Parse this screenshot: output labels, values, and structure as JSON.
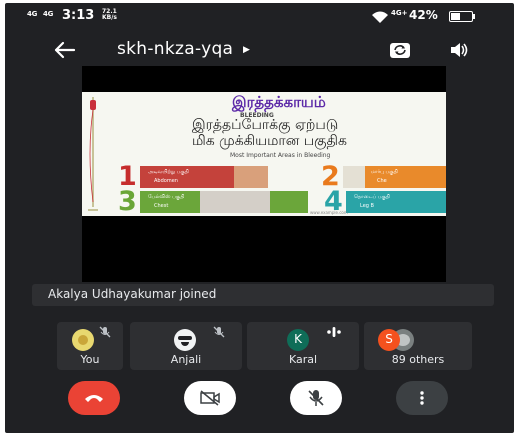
{
  "status_bar": {
    "net1": "4G",
    "net2": "4G",
    "time": "3:13",
    "speed_value": "72.1",
    "speed_unit": "KB/s",
    "wifi_label": "4G+",
    "battery": "42%"
  },
  "meeting": {
    "code": "skh-nkza-yqa",
    "back_icon": "arrow-left-icon",
    "switch_camera_icon": "switch-camera-icon",
    "audio_icon": "speaker-icon"
  },
  "presentation": {
    "title": "இரத்தக்காயம்",
    "subtitle": "BLEEDING",
    "line1": "இரத்தப்போக்கு ஏற்படு",
    "line2": "மிக முக்கியமான பகுதிக",
    "caption": "Most Important Areas in Bleeding",
    "cards": [
      {
        "number": "1",
        "label_ta": "அடிவயிற்று பகுதி",
        "label_en": "Abdomen"
      },
      {
        "number": "2",
        "label_ta": "மார்பு பகுதி",
        "label_en": "Che"
      },
      {
        "number": "3",
        "label_ta": "பேல்விஸ் பகுதி",
        "label_en": "Chest"
      },
      {
        "number": "4",
        "label_ta": "தொடைப் பகுதி",
        "label_en": "Leg B"
      }
    ],
    "link": "www.example.com"
  },
  "toast": "Akalya Udhayakumar joined",
  "participants": [
    {
      "name": "You",
      "muted": true
    },
    {
      "name": "Anjali",
      "muted": true
    },
    {
      "name": "Karal",
      "initial": "K",
      "speaking": true
    },
    {
      "name": "89 others",
      "initial": "S"
    }
  ],
  "controls": {
    "end_call_icon": "end-call-icon",
    "camera_off_icon": "camera-off-icon",
    "mic_off_icon": "mic-off-icon",
    "more_icon": "more-vertical-icon"
  },
  "colors": {
    "background": "#202124",
    "tile": "#2e2f32",
    "end_call": "#ea4335",
    "control_light": "#ffffff",
    "control_dark": "#3c4043",
    "karal_avatar": "#0f6d58",
    "others_avatar": "#f4511e"
  }
}
